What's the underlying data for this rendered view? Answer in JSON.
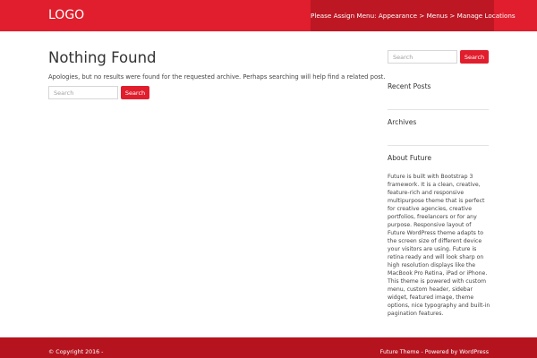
{
  "header": {
    "logo": "LOGO",
    "menu_notice": "Please Assign Menu: Appearance > Menus > Manage Locations"
  },
  "main": {
    "title": "Nothing Found",
    "message": "Apologies, but no results were found for the requested archive. Perhaps searching will help find a related post.",
    "search": {
      "placeholder": "Search",
      "button": "Search"
    }
  },
  "sidebar": {
    "search": {
      "placeholder": "Search",
      "button": "Search"
    },
    "recent_posts_title": "Recent Posts",
    "archives_title": "Archives",
    "about_title": "About Future",
    "about_text": "Future is built with Bootstrap 3 framework. It is a clean, creative, feature-rich and responsive multipurpose theme that is perfect for creative agencies, creative portfolios, freelancers or for any purpose. Responsive layout of Future WordPress theme adapts to the screen size of different device your visitors are using. Future is retina ready and will look sharp on high resolution displays like the MacBook Pro Retina, iPad or iPhone. This theme is powered with custom menu, custom header, sidebar widget, featured image, theme options, nice typography and built-in pagination features."
  },
  "footer": {
    "copyright": "© Copyright 2016 -",
    "theme_link": "Future Theme",
    "separator": " - Powered by ",
    "wordpress_link": "WordPress"
  },
  "colors": {
    "header_bg": "#e01e2d",
    "menu_notice_bg": "#bd1723",
    "footer_bg": "#b5141f",
    "button_bg": "#e01e2d"
  }
}
